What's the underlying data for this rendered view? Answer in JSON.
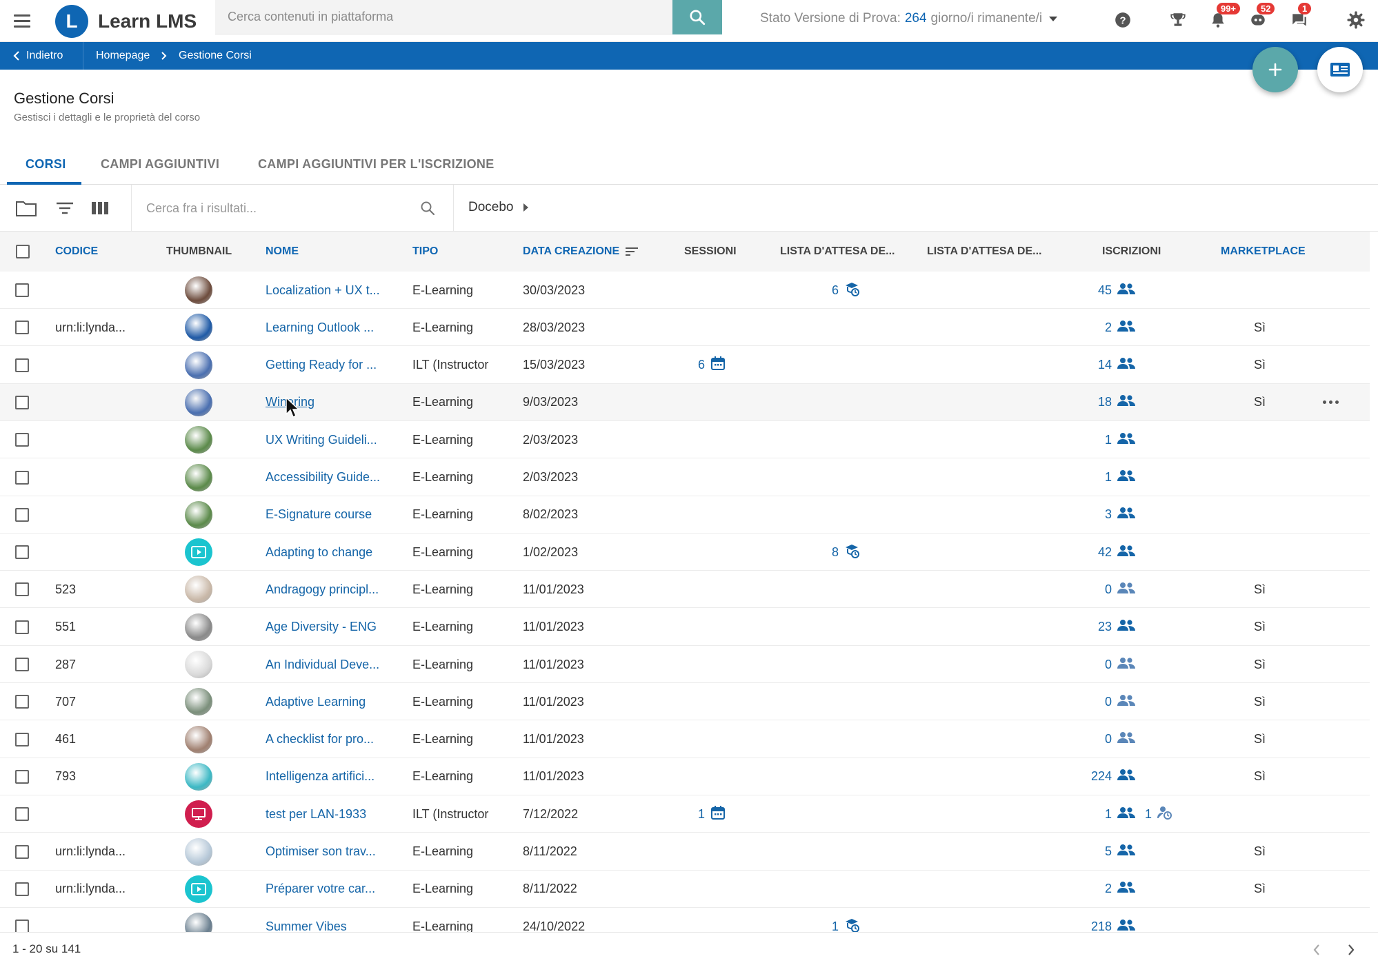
{
  "app": {
    "logo_letter": "L",
    "name": "Learn LMS",
    "brand_color": "#0f66b3",
    "accent_color": "#5ba8aa"
  },
  "header": {
    "search_placeholder": "Cerca contenuti in piattaforma",
    "trial_prefix": "Stato Versione di Prova:",
    "trial_days": "264",
    "trial_suffix": "giorno/i rimanente/i",
    "notifications_badge": "99+",
    "chat_badge": "52",
    "messages_badge": "1",
    "icons": [
      "help-icon",
      "trophy-icon",
      "bell-icon",
      "chat-bot-icon",
      "message-icon",
      "settings-icon"
    ]
  },
  "breadcrumb": {
    "back": "Indietro",
    "home": "Homepage",
    "current": "Gestione Corsi"
  },
  "page": {
    "title": "Gestione Corsi",
    "subtitle": "Gestisci i dettagli e le proprietà del corso"
  },
  "tabs": [
    {
      "label": "CORSI",
      "active": true
    },
    {
      "label": "CAMPI AGGIUNTIVI",
      "active": false
    },
    {
      "label": "CAMPI AGGIUNTIVI PER L'ISCRIZIONE",
      "active": false
    }
  ],
  "toolbar": {
    "search_placeholder": "Cerca fra i risultati...",
    "catalog": "Docebo"
  },
  "table": {
    "columns": {
      "code": "CODICE",
      "thumbnail": "THUMBNAIL",
      "name": "NOME",
      "type": "TIPO",
      "created": "DATA CREAZIONE",
      "sessions": "SESSIONI",
      "waitlist1": "LISTA D'ATTESA DE...",
      "waitlist2": "LISTA D'ATTESA DE...",
      "enrollments": "ISCRIZIONI",
      "marketplace": "MARKETPLACE"
    },
    "rows": [
      {
        "code": "",
        "thumb": "#6d4c3d",
        "thumb_kind": "photo",
        "name": "Localization + UX t...",
        "type": "E-Learning",
        "created": "30/03/2023",
        "sessions": "",
        "waitlist1": "6",
        "waitlist2": "",
        "enrollments": "45",
        "enroll_extra": "",
        "marketplace": ""
      },
      {
        "code": "urn:li:lynda...",
        "thumb": "#1f5aa6",
        "thumb_kind": "photo",
        "name": "Learning Outlook ...",
        "type": "E-Learning",
        "created": "28/03/2023",
        "sessions": "",
        "waitlist1": "",
        "waitlist2": "",
        "enrollments": "2",
        "enroll_extra": "",
        "marketplace": "Sì"
      },
      {
        "code": "",
        "thumb": "#4a6fb0",
        "thumb_kind": "photo",
        "name": "Getting Ready for ...",
        "type": "ILT (Instructor",
        "created": "15/03/2023",
        "sessions": "6",
        "waitlist1": "",
        "waitlist2": "",
        "enrollments": "14",
        "enroll_extra": "",
        "marketplace": "Sì"
      },
      {
        "code": "",
        "thumb": "#4a6fb0",
        "thumb_kind": "photo",
        "name": "Winering",
        "type": "E-Learning",
        "created": "9/03/2023",
        "sessions": "",
        "waitlist1": "",
        "waitlist2": "",
        "enrollments": "18",
        "enroll_extra": "",
        "marketplace": "Sì",
        "hover": true
      },
      {
        "code": "",
        "thumb": "#5b8a4a",
        "thumb_kind": "photo",
        "name": "UX Writing Guideli...",
        "type": "E-Learning",
        "created": "2/03/2023",
        "sessions": "",
        "waitlist1": "",
        "waitlist2": "",
        "enrollments": "1",
        "enroll_extra": "",
        "marketplace": ""
      },
      {
        "code": "",
        "thumb": "#5b8a4a",
        "thumb_kind": "photo",
        "name": "Accessibility Guide...",
        "type": "E-Learning",
        "created": "2/03/2023",
        "sessions": "",
        "waitlist1": "",
        "waitlist2": "",
        "enrollments": "1",
        "enroll_extra": "",
        "marketplace": ""
      },
      {
        "code": "",
        "thumb": "#5b8a4a",
        "thumb_kind": "photo",
        "name": "E-Signature course",
        "type": "E-Learning",
        "created": "8/02/2023",
        "sessions": "",
        "waitlist1": "",
        "waitlist2": "",
        "enrollments": "3",
        "enroll_extra": "",
        "marketplace": ""
      },
      {
        "code": "",
        "thumb": "#1bc4cf",
        "thumb_kind": "play",
        "name": "Adapting to change",
        "type": "E-Learning",
        "created": "1/02/2023",
        "sessions": "",
        "waitlist1": "8",
        "waitlist2": "",
        "enrollments": "42",
        "enroll_extra": "",
        "marketplace": ""
      },
      {
        "code": "523",
        "thumb": "#c9b8a8",
        "thumb_kind": "photo",
        "name": "Andragogy principl...",
        "type": "E-Learning",
        "created": "11/01/2023",
        "sessions": "",
        "waitlist1": "",
        "waitlist2": "",
        "enrollments": "0",
        "enroll_extra": "",
        "marketplace": "Sì"
      },
      {
        "code": "551",
        "thumb": "#8a8a8a",
        "thumb_kind": "photo",
        "name": "Age Diversity - ENG",
        "type": "E-Learning",
        "created": "11/01/2023",
        "sessions": "",
        "waitlist1": "",
        "waitlist2": "",
        "enrollments": "23",
        "enroll_extra": "",
        "marketplace": "Sì"
      },
      {
        "code": "287",
        "thumb": "#d9d9d9",
        "thumb_kind": "photo",
        "name": "An Individual Deve...",
        "type": "E-Learning",
        "created": "11/01/2023",
        "sessions": "",
        "waitlist1": "",
        "waitlist2": "",
        "enrollments": "0",
        "enroll_extra": "",
        "marketplace": "Sì"
      },
      {
        "code": "707",
        "thumb": "#7b8f7b",
        "thumb_kind": "photo",
        "name": "Adaptive Learning",
        "type": "E-Learning",
        "created": "11/01/2023",
        "sessions": "",
        "waitlist1": "",
        "waitlist2": "",
        "enrollments": "0",
        "enroll_extra": "",
        "marketplace": "Sì"
      },
      {
        "code": "461",
        "thumb": "#a08070",
        "thumb_kind": "photo",
        "name": "A checklist for pro...",
        "type": "E-Learning",
        "created": "11/01/2023",
        "sessions": "",
        "waitlist1": "",
        "waitlist2": "",
        "enrollments": "0",
        "enroll_extra": "",
        "marketplace": "Sì"
      },
      {
        "code": "793",
        "thumb": "#3cb8c4",
        "thumb_kind": "photo",
        "name": "Intelligenza artifici...",
        "type": "E-Learning",
        "created": "11/01/2023",
        "sessions": "",
        "waitlist1": "",
        "waitlist2": "",
        "enrollments": "224",
        "enroll_extra": "",
        "marketplace": "Sì"
      },
      {
        "code": "",
        "thumb": "#d01e4e",
        "thumb_kind": "screen",
        "name": "test per LAN-1933",
        "type": "ILT (Instructor",
        "created": "7/12/2022",
        "sessions": "1",
        "waitlist1": "",
        "waitlist2": "",
        "enrollments": "1",
        "enroll_extra": "1",
        "marketplace": ""
      },
      {
        "code": "urn:li:lynda...",
        "thumb": "#b6c8d8",
        "thumb_kind": "photo",
        "name": "Optimiser son trav...",
        "type": "E-Learning",
        "created": "8/11/2022",
        "sessions": "",
        "waitlist1": "",
        "waitlist2": "",
        "enrollments": "5",
        "enroll_extra": "",
        "marketplace": "Sì"
      },
      {
        "code": "urn:li:lynda...",
        "thumb": "#1bc4cf",
        "thumb_kind": "play",
        "name": "Préparer votre car...",
        "type": "E-Learning",
        "created": "8/11/2022",
        "sessions": "",
        "waitlist1": "",
        "waitlist2": "",
        "enrollments": "2",
        "enroll_extra": "",
        "marketplace": "Sì"
      },
      {
        "code": "",
        "thumb": "#6a7f8f",
        "thumb_kind": "photo",
        "name": "Summer Vibes",
        "type": "E-Learning",
        "created": "24/10/2022",
        "sessions": "",
        "waitlist1": "1",
        "waitlist2": "",
        "enrollments": "218",
        "enroll_extra": "",
        "marketplace": ""
      }
    ]
  },
  "footer": {
    "range": "1 - 20 su 141"
  }
}
